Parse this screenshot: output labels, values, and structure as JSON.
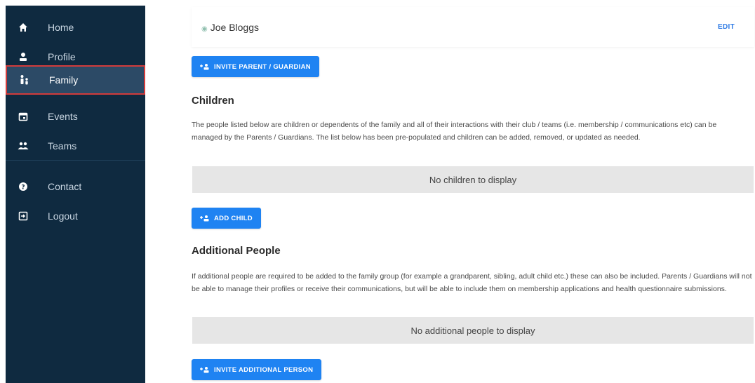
{
  "sidebar": {
    "items": [
      {
        "label": "Home",
        "icon": "home-icon"
      },
      {
        "label": "Profile",
        "icon": "user-icon"
      },
      {
        "label": "Family",
        "icon": "family-icon"
      },
      {
        "label": "Events",
        "icon": "calendar-icon"
      },
      {
        "label": "Teams",
        "icon": "group-icon"
      },
      {
        "label": "Contact",
        "icon": "help-icon"
      },
      {
        "label": "Logout",
        "icon": "logout-icon"
      }
    ],
    "active": "Family"
  },
  "header": {
    "name": "Joe Bloggs",
    "edit_label": "EDIT"
  },
  "buttons": {
    "invite_parent": "INVITE PARENT / GUARDIAN",
    "add_child": "ADD CHILD",
    "invite_additional": "INVITE ADDITIONAL PERSON"
  },
  "children": {
    "heading": "Children",
    "description": "The people listed below are children or dependents of the family and all of their interactions with their club / teams (i.e. membership / communications etc) can be managed by the Parents / Guardians. The list below has been pre-populated and children can be added, removed, or updated as needed.",
    "empty": "No children to display"
  },
  "additional": {
    "heading": "Additional People",
    "description": "If additional people are required to be added to the family group (for example a grandparent, sibling, adult child etc.) these can also be included. Parents / Guardians will not be able to manage their profiles or receive their communications, but will be able to include them on membership applications and health questionnaire submissions.",
    "empty": "No additional people to display"
  },
  "colors": {
    "sidebar_bg": "#0f2a40",
    "accent": "#1f83f2",
    "active_border": "#d23b3b"
  }
}
